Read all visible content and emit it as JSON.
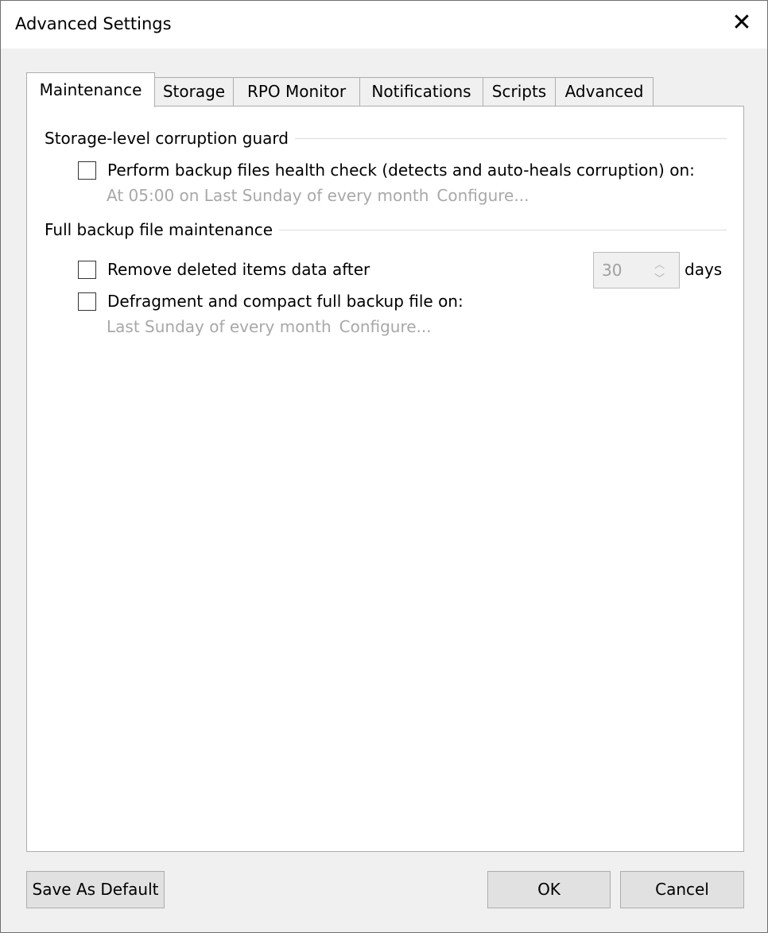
{
  "window": {
    "title": "Advanced Settings",
    "close": "✕"
  },
  "tabs": [
    {
      "label": "Maintenance",
      "active": true
    },
    {
      "label": "Storage"
    },
    {
      "label": "RPO Monitor"
    },
    {
      "label": "Notifications"
    },
    {
      "label": "Scripts"
    },
    {
      "label": "Advanced"
    }
  ],
  "corruption_guard": {
    "heading": "Storage-level corruption guard",
    "health_check_label": "Perform backup files health check (detects and auto-heals corruption) on:",
    "health_check_checked": false,
    "schedule": "At 05:00 on Last Sunday of every month",
    "configure": "Configure..."
  },
  "full_maintenance": {
    "heading": "Full backup file maintenance",
    "remove_label": "Remove deleted items data after",
    "remove_checked": false,
    "remove_days_value": "30",
    "days_unit": "days",
    "defrag_label": "Defragment and compact full backup file on:",
    "defrag_checked": false,
    "defrag_schedule": "Last Sunday of every month",
    "configure": "Configure..."
  },
  "buttons": {
    "save_default": "Save As Default",
    "ok": "OK",
    "cancel": "Cancel"
  }
}
